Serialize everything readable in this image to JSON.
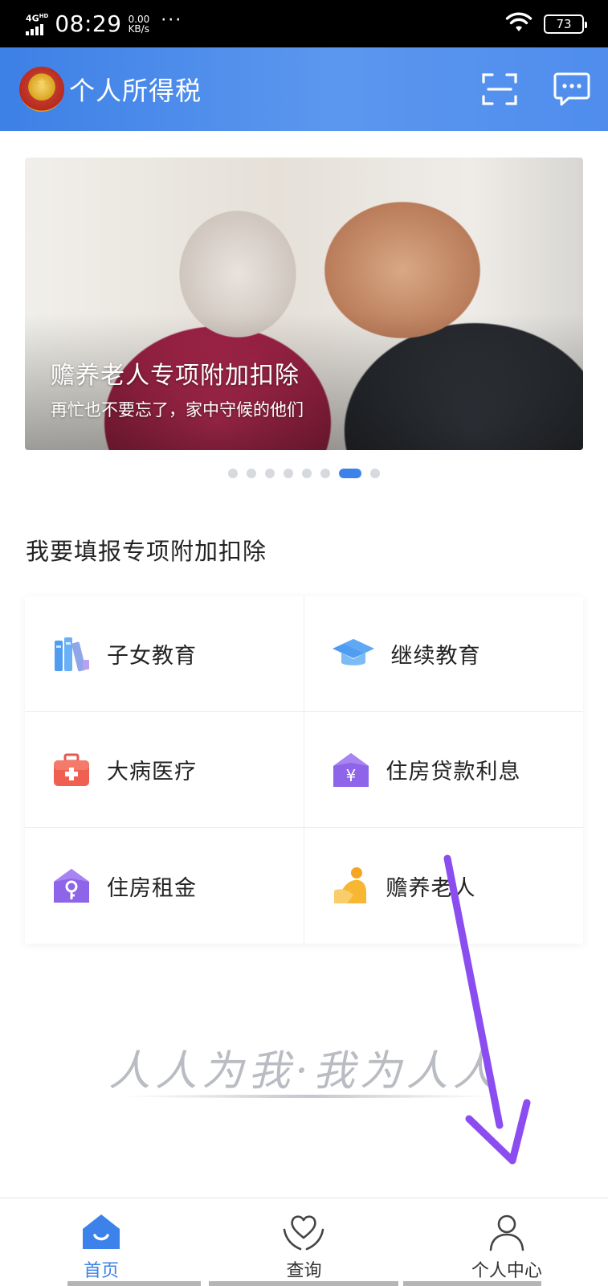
{
  "status_bar": {
    "network": "4G",
    "network_sub": "HD",
    "time": "08:29",
    "speed_value": "0.00",
    "speed_unit": "KB/s",
    "overflow": "···",
    "battery": "73"
  },
  "header": {
    "title": "个人所得税",
    "scan_icon": "scan-icon",
    "message_icon": "message-icon",
    "brand_color": "#4a8bec"
  },
  "banner": {
    "title": "赡养老人专项附加扣除",
    "subtitle": "再忙也不要忘了，家中守候的他们",
    "page_count": 8,
    "active_page": 7
  },
  "section": {
    "title": "我要填报专项附加扣除",
    "items": [
      {
        "label": "子女教育",
        "icon": "books-icon"
      },
      {
        "label": "继续教育",
        "icon": "graduation-cap-icon"
      },
      {
        "label": "大病医疗",
        "icon": "medical-kit-icon"
      },
      {
        "label": "住房贷款利息",
        "icon": "house-yuan-icon"
      },
      {
        "label": "住房租金",
        "icon": "house-key-icon"
      },
      {
        "label": "赡养老人",
        "icon": "elderly-care-icon"
      }
    ]
  },
  "slogan": "人人为我·我为人人",
  "bottom_nav": {
    "items": [
      {
        "label": "首页",
        "icon": "home-icon",
        "active": true
      },
      {
        "label": "查询",
        "icon": "heart-hands-icon",
        "active": false
      },
      {
        "label": "个人中心",
        "icon": "user-icon",
        "active": false
      }
    ]
  },
  "colors": {
    "accent": "#3c82ea",
    "annotation_arrow": "#8b4df0"
  }
}
